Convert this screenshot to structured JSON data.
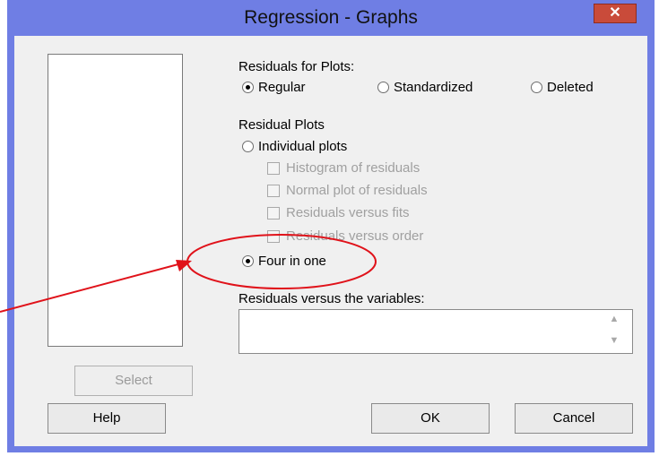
{
  "window": {
    "title": "Regression - Graphs",
    "close_label": "✕"
  },
  "residuals_for_plots": {
    "heading": "Residuals for Plots:",
    "options": [
      "Regular",
      "Standardized",
      "Deleted"
    ],
    "selected": "Regular"
  },
  "residual_plots": {
    "heading": "Residual Plots",
    "individual_label": "Individual plots",
    "checkboxes": [
      "Histogram of residuals",
      "Normal plot of residuals",
      "Residuals versus fits",
      "Residuals versus order"
    ],
    "four_in_one_label": "Four in one",
    "selected": "Four in one"
  },
  "variables": {
    "label": "Residuals versus the variables:",
    "value": ""
  },
  "buttons": {
    "select": "Select",
    "help": "Help",
    "ok": "OK",
    "cancel": "Cancel"
  },
  "colors": {
    "title_bar": "#6f7ee4",
    "annotation": "#e0121a",
    "close_button": "#c94b3a"
  }
}
